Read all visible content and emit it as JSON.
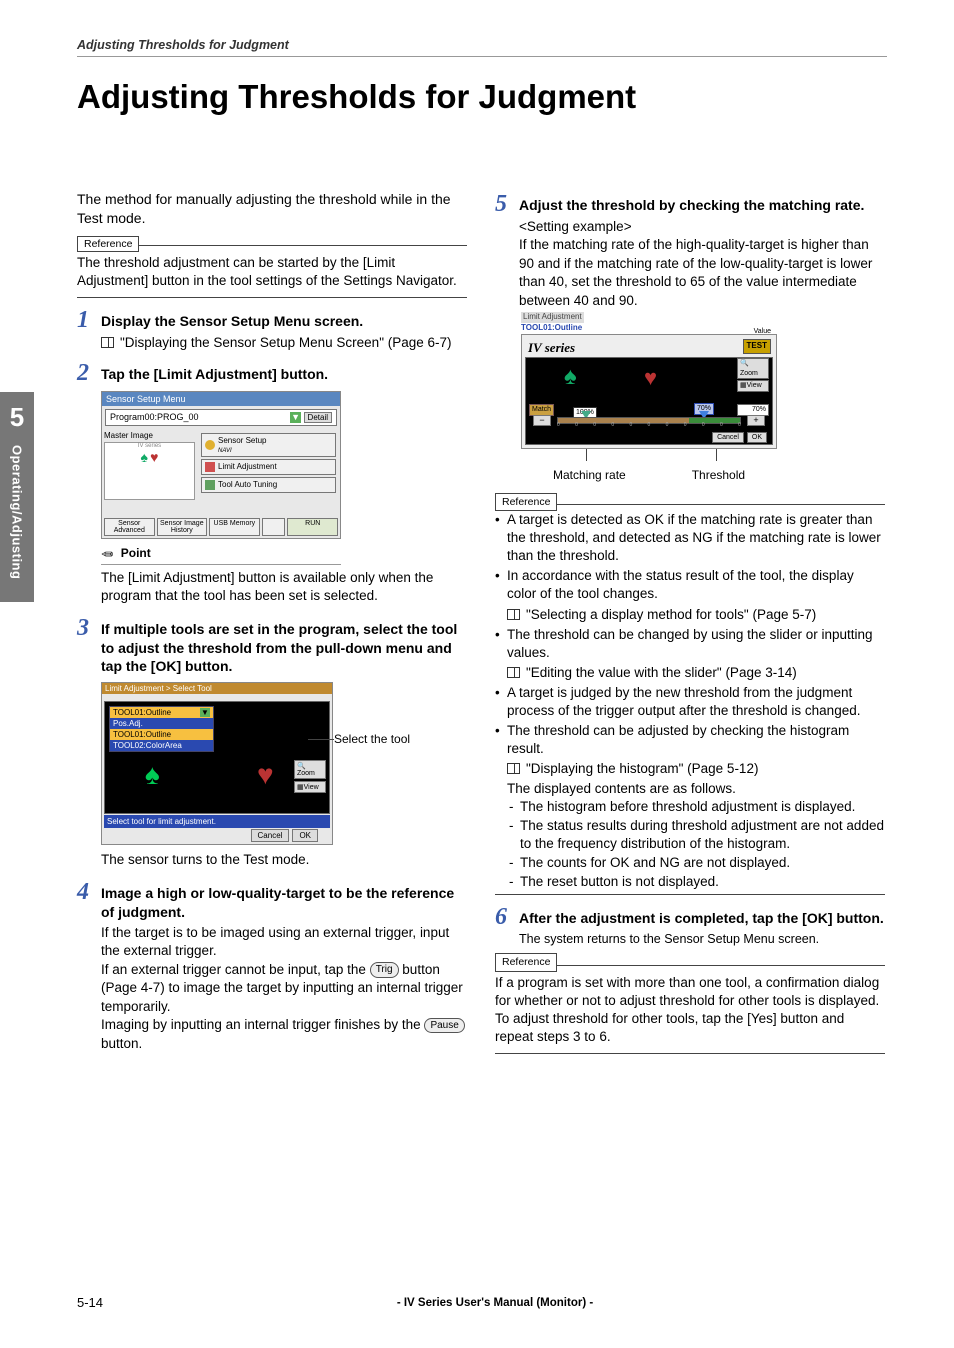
{
  "running_header": "Adjusting Thresholds for Judgment",
  "page_title": "Adjusting Thresholds for Judgment",
  "side_tab": {
    "number": "5",
    "label": "Operating/Adjusting"
  },
  "intro": "The method for manually adjusting the threshold while in the Test mode.",
  "ref1_label": "Reference",
  "ref1_body": "The threshold adjustment can be started by the [Limit Adjustment] button in the tool settings of the Settings Navigator.",
  "step1": {
    "num": "1",
    "title": "Display the Sensor Setup Menu screen.",
    "ref": "\"Displaying the Sensor Setup Menu Screen\" (Page 6-7)"
  },
  "step2": {
    "num": "2",
    "title": "Tap the [Limit Adjustment] button.",
    "img": {
      "titlebar": "Sensor Setup Menu",
      "program": "Program00:PROG_00",
      "detail": "Detail",
      "master": "Master Image",
      "iv": "IV series",
      "navbtn": "Sensor Setup",
      "navsub": "NAVI",
      "limit": "Limit Adjustment",
      "tuning": "Tool Auto Tuning",
      "b1": "Sensor Advanced",
      "b2": "Sensor Image History",
      "b3": "USB Memory",
      "b4": "RUN"
    },
    "point_label": "Point",
    "point_text": "The [Limit Adjustment] button is available only when the program that the tool has been set is selected."
  },
  "step3": {
    "num": "3",
    "title": "If multiple tools are set in the program, select the tool to adjust the threshold from the pull-down menu and tap the [OK] button.",
    "callout": "Select the tool",
    "img": {
      "bar": "Limit Adjustment > Select Tool",
      "sel0": "TOOL01:Outline",
      "opt0": "Pos.Adj.",
      "opt1": "TOOL01:Outline",
      "opt2": "TOOL02:ColorArea",
      "zoom": "Zoom",
      "view": "View",
      "msg": "Select tool for limit adjustment.",
      "cancel": "Cancel",
      "ok": "OK"
    },
    "after": "The sensor turns to the Test mode."
  },
  "step4": {
    "num": "4",
    "title": "Image a high or low-quality-target to be the reference of judgment.",
    "p1": "If the target is to be imaged using an external trigger, input the external trigger.",
    "p2a": "If an external trigger cannot be input, tap the ",
    "p2b": " button (Page 4-7) to image the target by inputting an internal trigger temporarily.",
    "p3a": "Imaging by inputting an internal trigger finishes by the ",
    "p3b": " button.",
    "trig_btn": "Trig",
    "pause_btn": "Pause"
  },
  "step5": {
    "num": "5",
    "title": "Adjust the threshold by checking the matching rate.",
    "sub": "<Setting example>",
    "para": "If the matching rate of the high-quality-target is higher than 90 and if the matching rate of the low-quality-target is lower than 40, set the threshold to 65 of the value intermediate between 40 and 90.",
    "img": {
      "t1": "Limit Adjustment",
      "t2": "TOOL01:Outline",
      "logo": "IV series",
      "value_lbl": "Value",
      "test": "TEST",
      "zoom": "Zoom",
      "view": "View",
      "match_lbl": "Match",
      "match_bubble": "100%",
      "thr_bubble": "70%",
      "pct": "70%",
      "cancel": "Cancel",
      "ok": "OK"
    },
    "label_match": "Matching rate",
    "label_thr": "Threshold",
    "ref_label": "Reference",
    "bullets": [
      "A target is detected as OK if the matching rate is greater than the threshold, and detected as NG if the matching rate is lower than the threshold.",
      "In accordance with the status result of the tool, the display color of the tool changes.",
      "The threshold can be changed by using the slider or inputting values.",
      "A target is judged by the new threshold from the judgment process of the trigger output after the threshold is changed.",
      "The threshold can be adjusted by checking the histogram result."
    ],
    "subref1": "\"Selecting a display method for tools\" (Page 5-7)",
    "subref2": "\"Editing the value with the slider\" (Page 3-14)",
    "subref3": "\"Displaying the histogram\" (Page 5-12)",
    "disp_line": "The displayed contents are as follows.",
    "dashes": [
      "The histogram before threshold adjustment is displayed.",
      "The status results during threshold adjustment are not added to the frequency distribution of the histogram.",
      "The counts for OK and NG are not displayed.",
      "The reset button is not displayed."
    ]
  },
  "step6": {
    "num": "6",
    "title": "After the adjustment is completed, tap the [OK] button.",
    "p1": "The system returns to the Sensor Setup Menu screen.",
    "ref_label": "Reference",
    "ref_body1": "If a program is set with more than one tool, a confirmation dialog for whether or not to adjust threshold for other tools is displayed.",
    "ref_body2": "To adjust threshold for other tools, tap the [Yes] button and repeat steps 3 to 6."
  },
  "footer": {
    "page": "5-14",
    "manual": "- IV Series User's Manual (Monitor) -"
  }
}
